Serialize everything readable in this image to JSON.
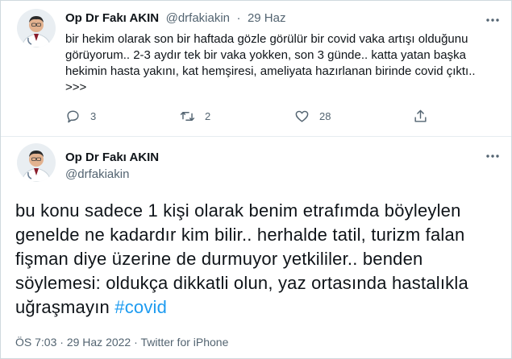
{
  "tweet1": {
    "author_name": "Op Dr Fakı AKIN",
    "handle": "@drfakiakin",
    "separator": "·",
    "date": "29 Haz",
    "text": "bir hekim olarak son bir haftada gözle görülür bir covid vaka artışı olduğunu görüyorum.. 2-3 aydır tek bir vaka yokken, son 3 günde.. katta yatan başka hekimin hasta yakını, kat hemşiresi, ameliyata hazırlanan birinde covid çıktı.. >>>",
    "replies": "3",
    "retweets": "2",
    "likes": "28"
  },
  "tweet2": {
    "author_name": "Op Dr Fakı AKIN",
    "handle": "@drfakiakin",
    "text": "bu konu sadece 1 kişi olarak benim etrafımda böyleylen genelde ne kadardır kim bilir.. herhalde tatil, turizm falan fişman diye üzerine de durmuyor yetkililer.. benden söylemesi: oldukça dikkatli olun, yaz ortasında hastalıkla uğraşmayın",
    "hashtag": "#covid",
    "time": "ÖS 7:03",
    "date": "29 Haz 2022",
    "separator": "·",
    "source": "Twitter for iPhone"
  },
  "colors": {
    "link": "#1d9bf0",
    "muted": "#536471",
    "text": "#0f1419"
  },
  "icons": [
    "reply-icon",
    "retweet-icon",
    "like-icon",
    "share-icon",
    "more-icon"
  ]
}
